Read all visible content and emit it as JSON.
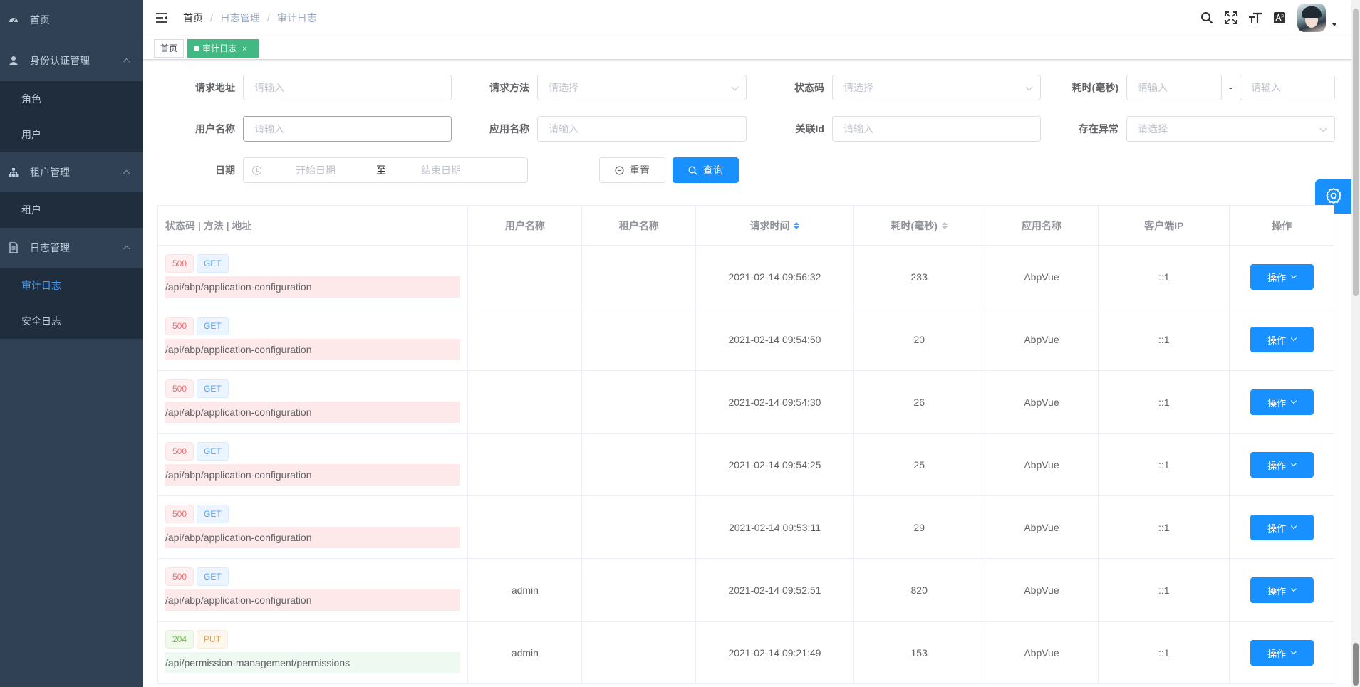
{
  "sidebar": {
    "home": "首页",
    "identity": {
      "label": "身份认证管理",
      "items": [
        "角色",
        "用户"
      ]
    },
    "tenant": {
      "label": "租户管理",
      "items": [
        "租户"
      ]
    },
    "logs": {
      "label": "日志管理",
      "items": [
        "审计日志",
        "安全日志"
      ]
    },
    "bg_color": "#304156",
    "active_color": "#409eff"
  },
  "breadcrumb": [
    "首页",
    "日志管理",
    "审计日志"
  ],
  "tags": {
    "home": "首页",
    "active": "审计日志",
    "close": "×",
    "active_color": "#42b983"
  },
  "filters": {
    "request_url": {
      "label": "请求地址",
      "placeholder": "请输入"
    },
    "request_method": {
      "label": "请求方法",
      "placeholder": "请选择"
    },
    "status_code": {
      "label": "状态码",
      "placeholder": "请选择"
    },
    "duration": {
      "label": "耗时(毫秒)",
      "min_placeholder": "请输入",
      "max_placeholder": "请输入",
      "separator": "-"
    },
    "user_name": {
      "label": "用户名称",
      "placeholder": "请输入"
    },
    "app_name": {
      "label": "应用名称",
      "placeholder": "请输入"
    },
    "correlation_id": {
      "label": "关联Id",
      "placeholder": "请输入"
    },
    "has_exception": {
      "label": "存在异常",
      "placeholder": "请选择"
    },
    "date": {
      "label": "日期",
      "start_placeholder": "开始日期",
      "separator": "至",
      "end_placeholder": "结束日期"
    },
    "reset_label": "重置",
    "query_label": "查询"
  },
  "table": {
    "headers": [
      "状态码 | 方法 | 地址",
      "用户名称",
      "租户名称",
      "请求时间",
      "耗时(毫秒)",
      "应用名称",
      "客户端IP",
      "操作"
    ],
    "action_label": "操作",
    "rows": [
      {
        "status": "500",
        "method": "GET",
        "url": "/api/abp/application-configuration",
        "user": "",
        "tenant": "",
        "time": "2021-02-14 09:56:32",
        "duration": "233",
        "app": "AbpVue",
        "ip": "::1"
      },
      {
        "status": "500",
        "method": "GET",
        "url": "/api/abp/application-configuration",
        "user": "",
        "tenant": "",
        "time": "2021-02-14 09:54:50",
        "duration": "20",
        "app": "AbpVue",
        "ip": "::1"
      },
      {
        "status": "500",
        "method": "GET",
        "url": "/api/abp/application-configuration",
        "user": "",
        "tenant": "",
        "time": "2021-02-14 09:54:30",
        "duration": "26",
        "app": "AbpVue",
        "ip": "::1"
      },
      {
        "status": "500",
        "method": "GET",
        "url": "/api/abp/application-configuration",
        "user": "",
        "tenant": "",
        "time": "2021-02-14 09:54:25",
        "duration": "25",
        "app": "AbpVue",
        "ip": "::1"
      },
      {
        "status": "500",
        "method": "GET",
        "url": "/api/abp/application-configuration",
        "user": "",
        "tenant": "",
        "time": "2021-02-14 09:53:11",
        "duration": "29",
        "app": "AbpVue",
        "ip": "::1"
      },
      {
        "status": "500",
        "method": "GET",
        "url": "/api/abp/application-configuration",
        "user": "admin",
        "tenant": "",
        "time": "2021-02-14 09:52:51",
        "duration": "820",
        "app": "AbpVue",
        "ip": "::1"
      },
      {
        "status": "204",
        "method": "PUT",
        "url": "/api/permission-management/permissions",
        "user": "admin",
        "tenant": "",
        "time": "2021-02-14 09:21:49",
        "duration": "153",
        "app": "AbpVue",
        "ip": "::1"
      }
    ]
  },
  "colors": {
    "primary": "#1890ff",
    "error_row": "#fde9ea",
    "ok_row": "#eef9f1"
  }
}
